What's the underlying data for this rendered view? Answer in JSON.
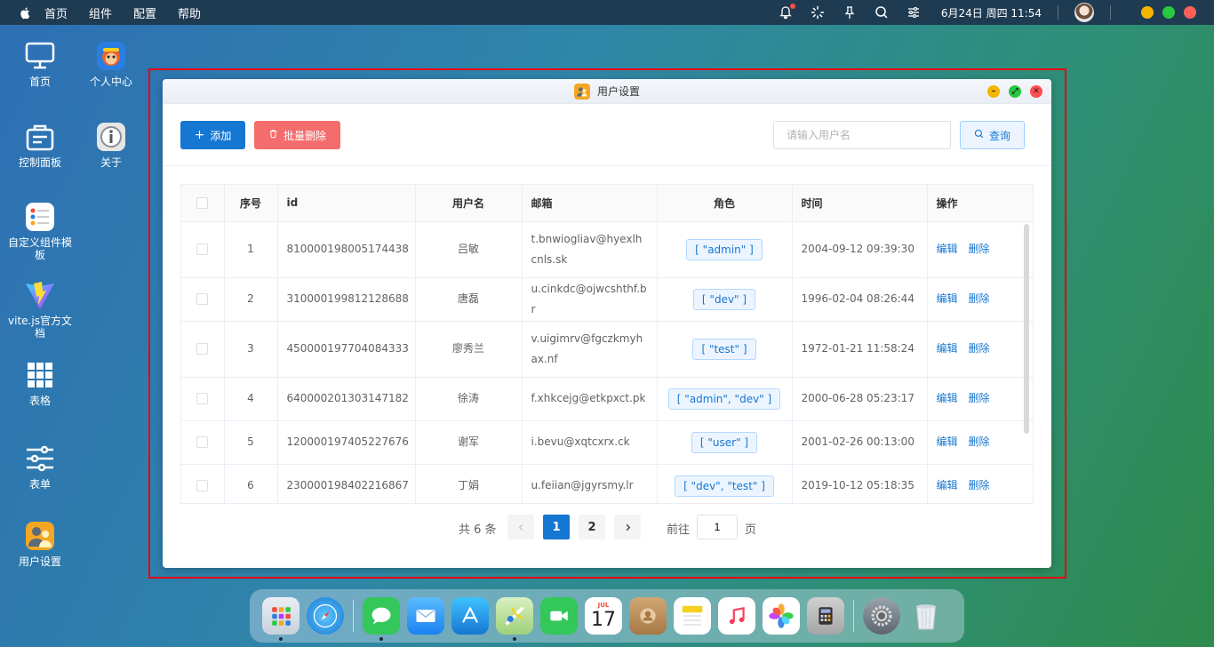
{
  "menubar": {
    "items": [
      "首页",
      "组件",
      "配置",
      "帮助"
    ],
    "datetime": "6月24日 周四 11:54"
  },
  "desktop": {
    "icons": [
      {
        "label": "首页",
        "icon": "monitor-icon"
      },
      {
        "label": "个人中心",
        "icon": "monkey-app-icon"
      },
      {
        "label": "控制面板",
        "icon": "control-panel-icon"
      },
      {
        "label": "关于",
        "icon": "info-icon"
      },
      {
        "label": "自定义组件模板",
        "icon": "list-template-icon"
      },
      {
        "label": "vite.js官方文档",
        "icon": "vite-logo-icon"
      },
      {
        "label": "表格",
        "icon": "grid-icon"
      },
      {
        "label": "表单",
        "icon": "sliders-icon"
      },
      {
        "label": "用户设置",
        "icon": "user-settings-icon"
      }
    ]
  },
  "window": {
    "title": "用户设置",
    "add_label": "添加",
    "batch_delete_label": "批量删除",
    "search_placeholder": "请输入用户名",
    "query_label": "查询",
    "columns": [
      "序号",
      "id",
      "用户名",
      "邮箱",
      "角色",
      "时间",
      "操作"
    ],
    "rows": [
      {
        "no": "1",
        "id": "810000198005174438",
        "name": "吕敏",
        "email": "t.bnwiogliav@hyexlhcnls.sk",
        "role": "[ \"admin\" ]",
        "time": "2004-09-12 09:39:30"
      },
      {
        "no": "2",
        "id": "310000199812128688",
        "name": "唐磊",
        "email": "u.cinkdc@ojwcshthf.br",
        "role": "[ \"dev\" ]",
        "time": "1996-02-04 08:26:44"
      },
      {
        "no": "3",
        "id": "450000197704084333",
        "name": "廖秀兰",
        "email": "v.uigimrv@fgczkmyhax.nf",
        "role": "[ \"test\" ]",
        "time": "1972-01-21 11:58:24"
      },
      {
        "no": "4",
        "id": "640000201303147182",
        "name": "徐涛",
        "email": "f.xhkcejg@etkpxct.pk",
        "role": "[ \"admin\", \"dev\" ]",
        "time": "2000-06-28 05:23:17"
      },
      {
        "no": "5",
        "id": "120000197405227676",
        "name": "谢军",
        "email": "i.bevu@xqtcxrx.ck",
        "role": "[ \"user\" ]",
        "time": "2001-02-26 00:13:00"
      },
      {
        "no": "6",
        "id": "230000198402216867",
        "name": "丁娟",
        "email": "u.feiian@jgyrsmy.lr",
        "role": "[ \"dev\", \"test\" ]",
        "time": "2019-10-12 05:18:35"
      }
    ],
    "edit_label": "编辑",
    "delete_label": "删除",
    "pagination": {
      "total": "共 6 条",
      "pages": [
        "1",
        "2"
      ],
      "current": "1",
      "goto_label": "前往",
      "goto_value": "1",
      "unit_label": "页"
    }
  },
  "colors": {
    "primary": "#1677d2",
    "danger": "#f56c6c",
    "highlight": "#e60012"
  }
}
